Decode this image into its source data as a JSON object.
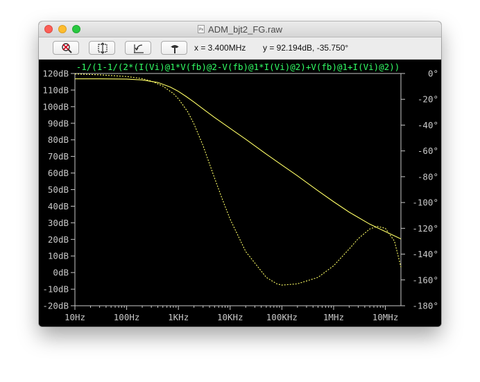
{
  "window": {
    "title": "ADM_bjt2_FG.raw",
    "file_icon_label": "Ps"
  },
  "toolbar": {
    "buttons": [
      {
        "icon": "zoom-cancel-icon"
      },
      {
        "icon": "zoom-extents-icon"
      },
      {
        "icon": "zoom-back-icon"
      },
      {
        "icon": "autorange-icon"
      }
    ],
    "x_readout": "x = 3.400MHz",
    "y_readout": "y = 92.194dB, -35.750°"
  },
  "colors": {
    "background": "#000000",
    "trace": "#ffff66",
    "axis": "#c8c8c8",
    "trace_label": "#33ff66",
    "tick_text": "#c8c8c8"
  },
  "chart_data": {
    "type": "line",
    "title": "-1/(1-1/(2*(I(Vi)@1*V(fb)@2-V(fb)@1*I(Vi)@2)+V(fb)@1+I(Vi)@2))",
    "x_scale": "log",
    "xlim": [
      10,
      20000000
    ],
    "x_ticks": [
      {
        "value": 10,
        "label": "10Hz"
      },
      {
        "value": 100,
        "label": "100Hz"
      },
      {
        "value": 1000,
        "label": "1KHz"
      },
      {
        "value": 10000,
        "label": "10KHz"
      },
      {
        "value": 100000,
        "label": "100KHz"
      },
      {
        "value": 1000000,
        "label": "1MHz"
      },
      {
        "value": 10000000,
        "label": "10MHz"
      }
    ],
    "ylim_left": [
      -20,
      120
    ],
    "y_left_ticks": [
      {
        "value": 120,
        "label": "120dB"
      },
      {
        "value": 110,
        "label": "110dB"
      },
      {
        "value": 100,
        "label": "100dB"
      },
      {
        "value": 90,
        "label": "90dB"
      },
      {
        "value": 80,
        "label": "80dB"
      },
      {
        "value": 70,
        "label": "70dB"
      },
      {
        "value": 60,
        "label": "60dB"
      },
      {
        "value": 50,
        "label": "50dB"
      },
      {
        "value": 40,
        "label": "40dB"
      },
      {
        "value": 30,
        "label": "30dB"
      },
      {
        "value": 20,
        "label": "20dB"
      },
      {
        "value": 10,
        "label": "10dB"
      },
      {
        "value": 0,
        "label": "0dB"
      },
      {
        "value": -10,
        "label": "-10dB"
      },
      {
        "value": -20,
        "label": "-20dB"
      }
    ],
    "ylim_right": [
      -180,
      0
    ],
    "y_right_ticks": [
      {
        "value": 0,
        "label": "0°"
      },
      {
        "value": -20,
        "label": "-20°"
      },
      {
        "value": -40,
        "label": "-40°"
      },
      {
        "value": -60,
        "label": "-60°"
      },
      {
        "value": -80,
        "label": "-80°"
      },
      {
        "value": -100,
        "label": "-100°"
      },
      {
        "value": -120,
        "label": "-120°"
      },
      {
        "value": -140,
        "label": "-140°"
      },
      {
        "value": -160,
        "label": "-160°"
      },
      {
        "value": -180,
        "label": "-180°"
      }
    ],
    "series": [
      {
        "kind": "magnitude",
        "axis": "left",
        "style": "solid",
        "x": [
          10,
          30,
          100,
          200,
          400,
          700,
          1000,
          1400,
          2000,
          3000,
          5000,
          10000,
          20000,
          50000,
          100000,
          200000,
          500000,
          1000000,
          2000000,
          5000000,
          10000000,
          20000000
        ],
        "y": [
          116.8,
          116.8,
          116.6,
          116.1,
          114.6,
          111.8,
          109.2,
          106.2,
          102.8,
          98.6,
          93.5,
          86.9,
          80.4,
          71.4,
          64.8,
          58.3,
          49.3,
          42.7,
          36.4,
          29.2,
          24.7,
          20.3
        ]
      },
      {
        "kind": "phase",
        "axis": "right",
        "style": "dashed",
        "x": [
          10,
          30,
          100,
          200,
          300,
          500,
          800,
          1000,
          1500,
          2000,
          3000,
          5000,
          7000,
          10000,
          20000,
          50000,
          80000,
          100000,
          200000,
          500000,
          1000000,
          2000000,
          3000000,
          5000000,
          7000000,
          10000000,
          15000000,
          20000000
        ],
        "y": [
          -0.4,
          -1.0,
          -2.3,
          -4.0,
          -5.9,
          -9.7,
          -15.6,
          -19.6,
          -29.4,
          -39.0,
          -56.0,
          -81.0,
          -97.0,
          -113.0,
          -138.0,
          -158.0,
          -163.0,
          -164.0,
          -163.0,
          -158.0,
          -149.0,
          -136.0,
          -128.0,
          -120.5,
          -118.5,
          -120.0,
          -130.0,
          -150.0
        ]
      }
    ]
  }
}
